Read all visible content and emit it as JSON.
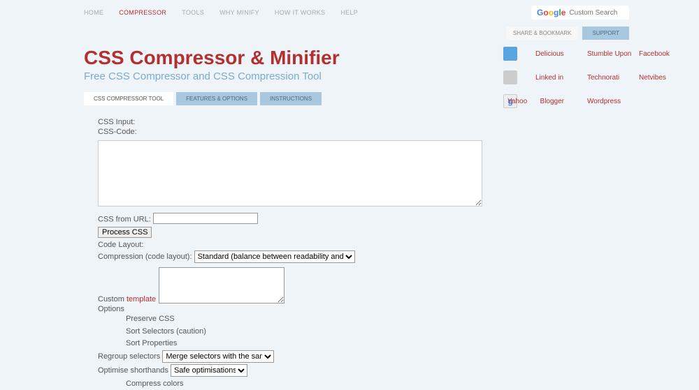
{
  "nav": {
    "home": "HOME",
    "compressor": "COMPRESSOR",
    "tools": "TOOLS",
    "why": "WHY MINIFY",
    "how": "HOW IT WORKS",
    "help": "HELP"
  },
  "search": {
    "placeholder": "Custom Search",
    "brand": "Google"
  },
  "actions": {
    "share": "SHARE & BOOKMARK",
    "support": "SUPPORT"
  },
  "header": {
    "title": "CSS Compressor & Minifier",
    "subtitle": "Free CSS Compressor and CSS Compression Tool"
  },
  "tabs": {
    "tool": "CSS COMPRESSOR TOOL",
    "features": "FEATURES & OPTIONS",
    "instructions": "INSTRUCTIONS"
  },
  "form": {
    "css_input": "CSS Input:",
    "css_code": "CSS-Code:",
    "css_from_url": "CSS from URL:",
    "process": "Process CSS",
    "code_layout": "Code Layout:",
    "compression_label": "Compression (code layout):",
    "compression_option": "Standard (balance between readability and size)",
    "custom": "Custom ",
    "template": "template",
    "options": "Options",
    "opt_preserve": "Preserve CSS",
    "opt_sort_sel": "Sort Selectors (caution)",
    "opt_sort_prop": "Sort Properties",
    "regroup_label": "Regroup selectors",
    "regroup_option": "Merge selectors with the same",
    "shorthand_label": "Optimise shorthands",
    "shorthand_option": "Safe optimisations",
    "opt_compress_colors": "Compress colors"
  },
  "social": {
    "delicious": "Delicious",
    "stumble": "Stumble Upon",
    "facebook": "Facebook",
    "linkedin": "Linked in",
    "technorati": "Technorati",
    "netvibes": "Netvibes",
    "yahoo": "Yahoo",
    "blogger": "Blogger",
    "wordpress": "Wordpress"
  }
}
